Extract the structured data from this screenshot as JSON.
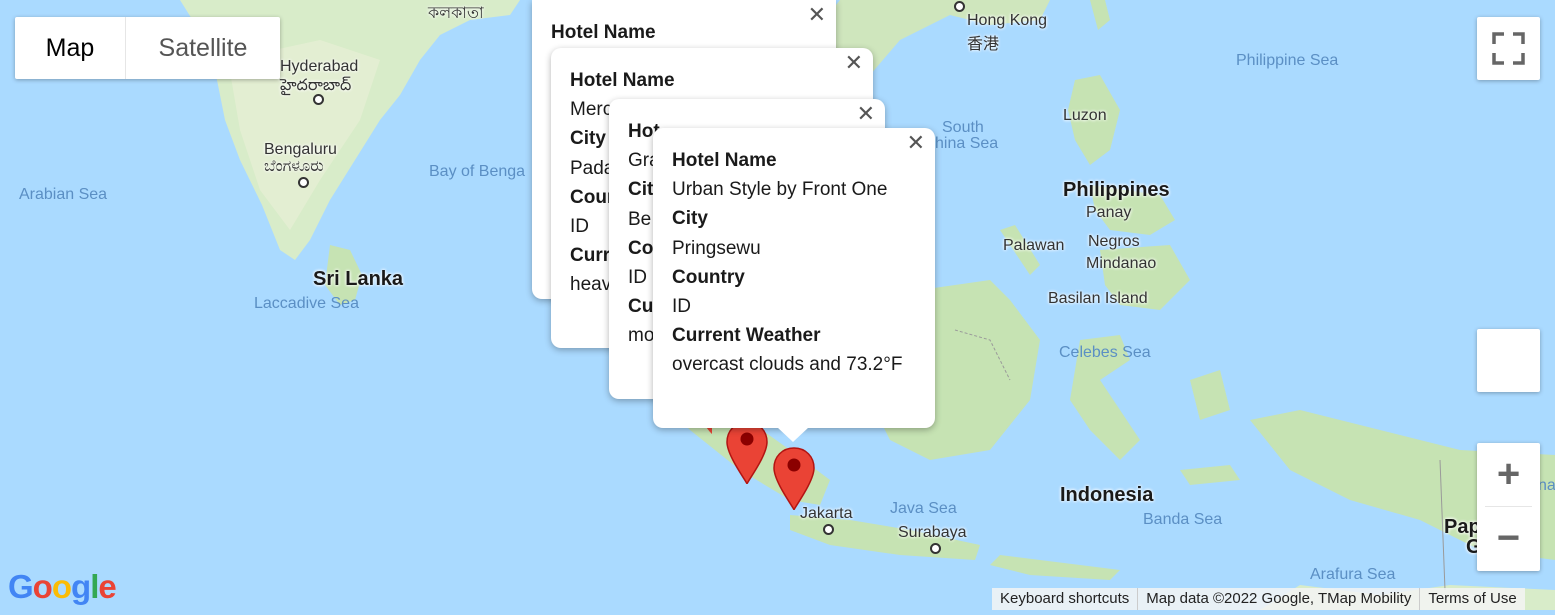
{
  "map_type_control": {
    "map_label": "Map",
    "satellite_label": "Satellite"
  },
  "labels": {
    "kolkata": "কলকাতা",
    "hong_kong": "Hong Kong",
    "hong_kong_cn": "香港",
    "hyderabad": "Hyderabad",
    "hyderabad_te": "హైదరాబాద్",
    "bengaluru": "Bengaluru",
    "bengaluru_kn": "ಬೆಂಗಳೂರು",
    "arabian_sea": "Arabian Sea",
    "bay_of_bengal": "Bay of Benga",
    "sri_lanka": "Sri Lanka",
    "laccadive_sea": "Laccadive Sea",
    "philippine_sea": "Philippine Sea",
    "luzon": "Luzon",
    "south_china_sea_1": "South",
    "south_china_sea_2": "hina Sea",
    "philippines": "Philippines",
    "panay": "Panay",
    "palawan": "Palawan",
    "negros": "Negros",
    "mindanao": "Mindanao",
    "basilan": "Basilan Island",
    "celebes_sea": "Celebes Sea",
    "java_sea": "Java Sea",
    "indonesia": "Indonesia",
    "banda_sea": "Banda Sea",
    "jakarta": "Jakarta",
    "surabaya": "Surabaya",
    "arafura_sea": "Arafura Sea",
    "papua_1": "Pap",
    "papua_2": "G",
    "na": "na"
  },
  "info_windows": [
    {
      "lines": [
        "Hotel Name"
      ]
    },
    {
      "lines": [
        "Hotel Name",
        "Merc",
        "City",
        "Pada",
        "Coun",
        "ID",
        "Curr",
        "heav"
      ]
    },
    {
      "lines": [
        "Hot",
        "Gra",
        "Cit",
        "Be",
        "Co",
        "ID",
        "Cu",
        "mo"
      ]
    },
    {
      "lines": [
        "Hotel Name",
        "Urban Style by Front One",
        "City",
        "Pringsewu",
        "Country",
        "ID",
        "Current Weather",
        "overcast clouds and 73.2°F"
      ]
    }
  ],
  "close_glyph": "✕",
  "zoom": {
    "in": "+",
    "out": "−"
  },
  "footer": {
    "keyboard": "Keyboard shortcuts",
    "mapdata": "Map data ©2022 Google, TMap Mobility",
    "terms": "Terms of Use"
  },
  "logo_letters": [
    "G",
    "o",
    "o",
    "g",
    "l",
    "e"
  ],
  "colors": {
    "water": "#aadaff",
    "land": "#d6ead0",
    "marker": "#ea4335"
  }
}
